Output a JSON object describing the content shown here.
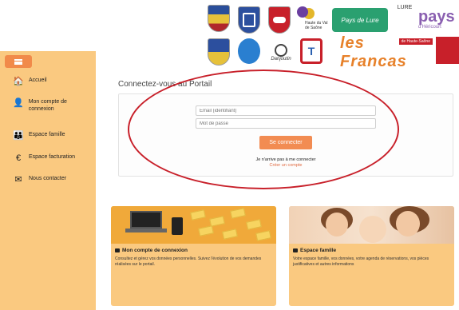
{
  "logos": {
    "vals_de_saone_label": "Haute du Val de Saône",
    "pays_de_lure": "Pays de Lure",
    "lure_label": "LURE",
    "pays_big": "pays",
    "pays_small": "d'Héricourt",
    "danjoutin": "Danjoutin",
    "t_letter": "T",
    "francas": "les Francas",
    "francas_tag": "de Haute-Saône"
  },
  "sidebar": {
    "items": [
      {
        "label": "Accueil",
        "icon": "home-icon",
        "glyph": "🏠"
      },
      {
        "label": "Mon compte de connexion",
        "icon": "user-icon",
        "glyph": "👤"
      },
      {
        "label": "Espace famille",
        "icon": "family-icon",
        "glyph": "👪"
      },
      {
        "label": "Espace facturation",
        "icon": "euro-icon",
        "glyph": "€"
      },
      {
        "label": "Nous contacter",
        "icon": "envelope-icon",
        "glyph": "✉"
      }
    ]
  },
  "portal": {
    "title": "Connectez-vous au Portail",
    "email_placeholder": "Email (identifiant)",
    "password_placeholder": "Mot de passe",
    "login_button": "Se connecter",
    "no_account": "Je n'arrive pas à me connecter",
    "create_account": "Créer un compte"
  },
  "cards": [
    {
      "title": "Mon compte de connexion",
      "text": "Consultez et gérez vos données personnelles. Suivez l'évolution de vos demandes réalisées sur le portail."
    },
    {
      "title": "Espace famille",
      "text": "Votre espace famille, vos données, votre agenda de réservations, vos pièces justificatives et autres informations"
    }
  ],
  "colors": {
    "sidebar": "#fac980",
    "accent": "#f28c52",
    "highlight_oval": "#c8202a"
  }
}
